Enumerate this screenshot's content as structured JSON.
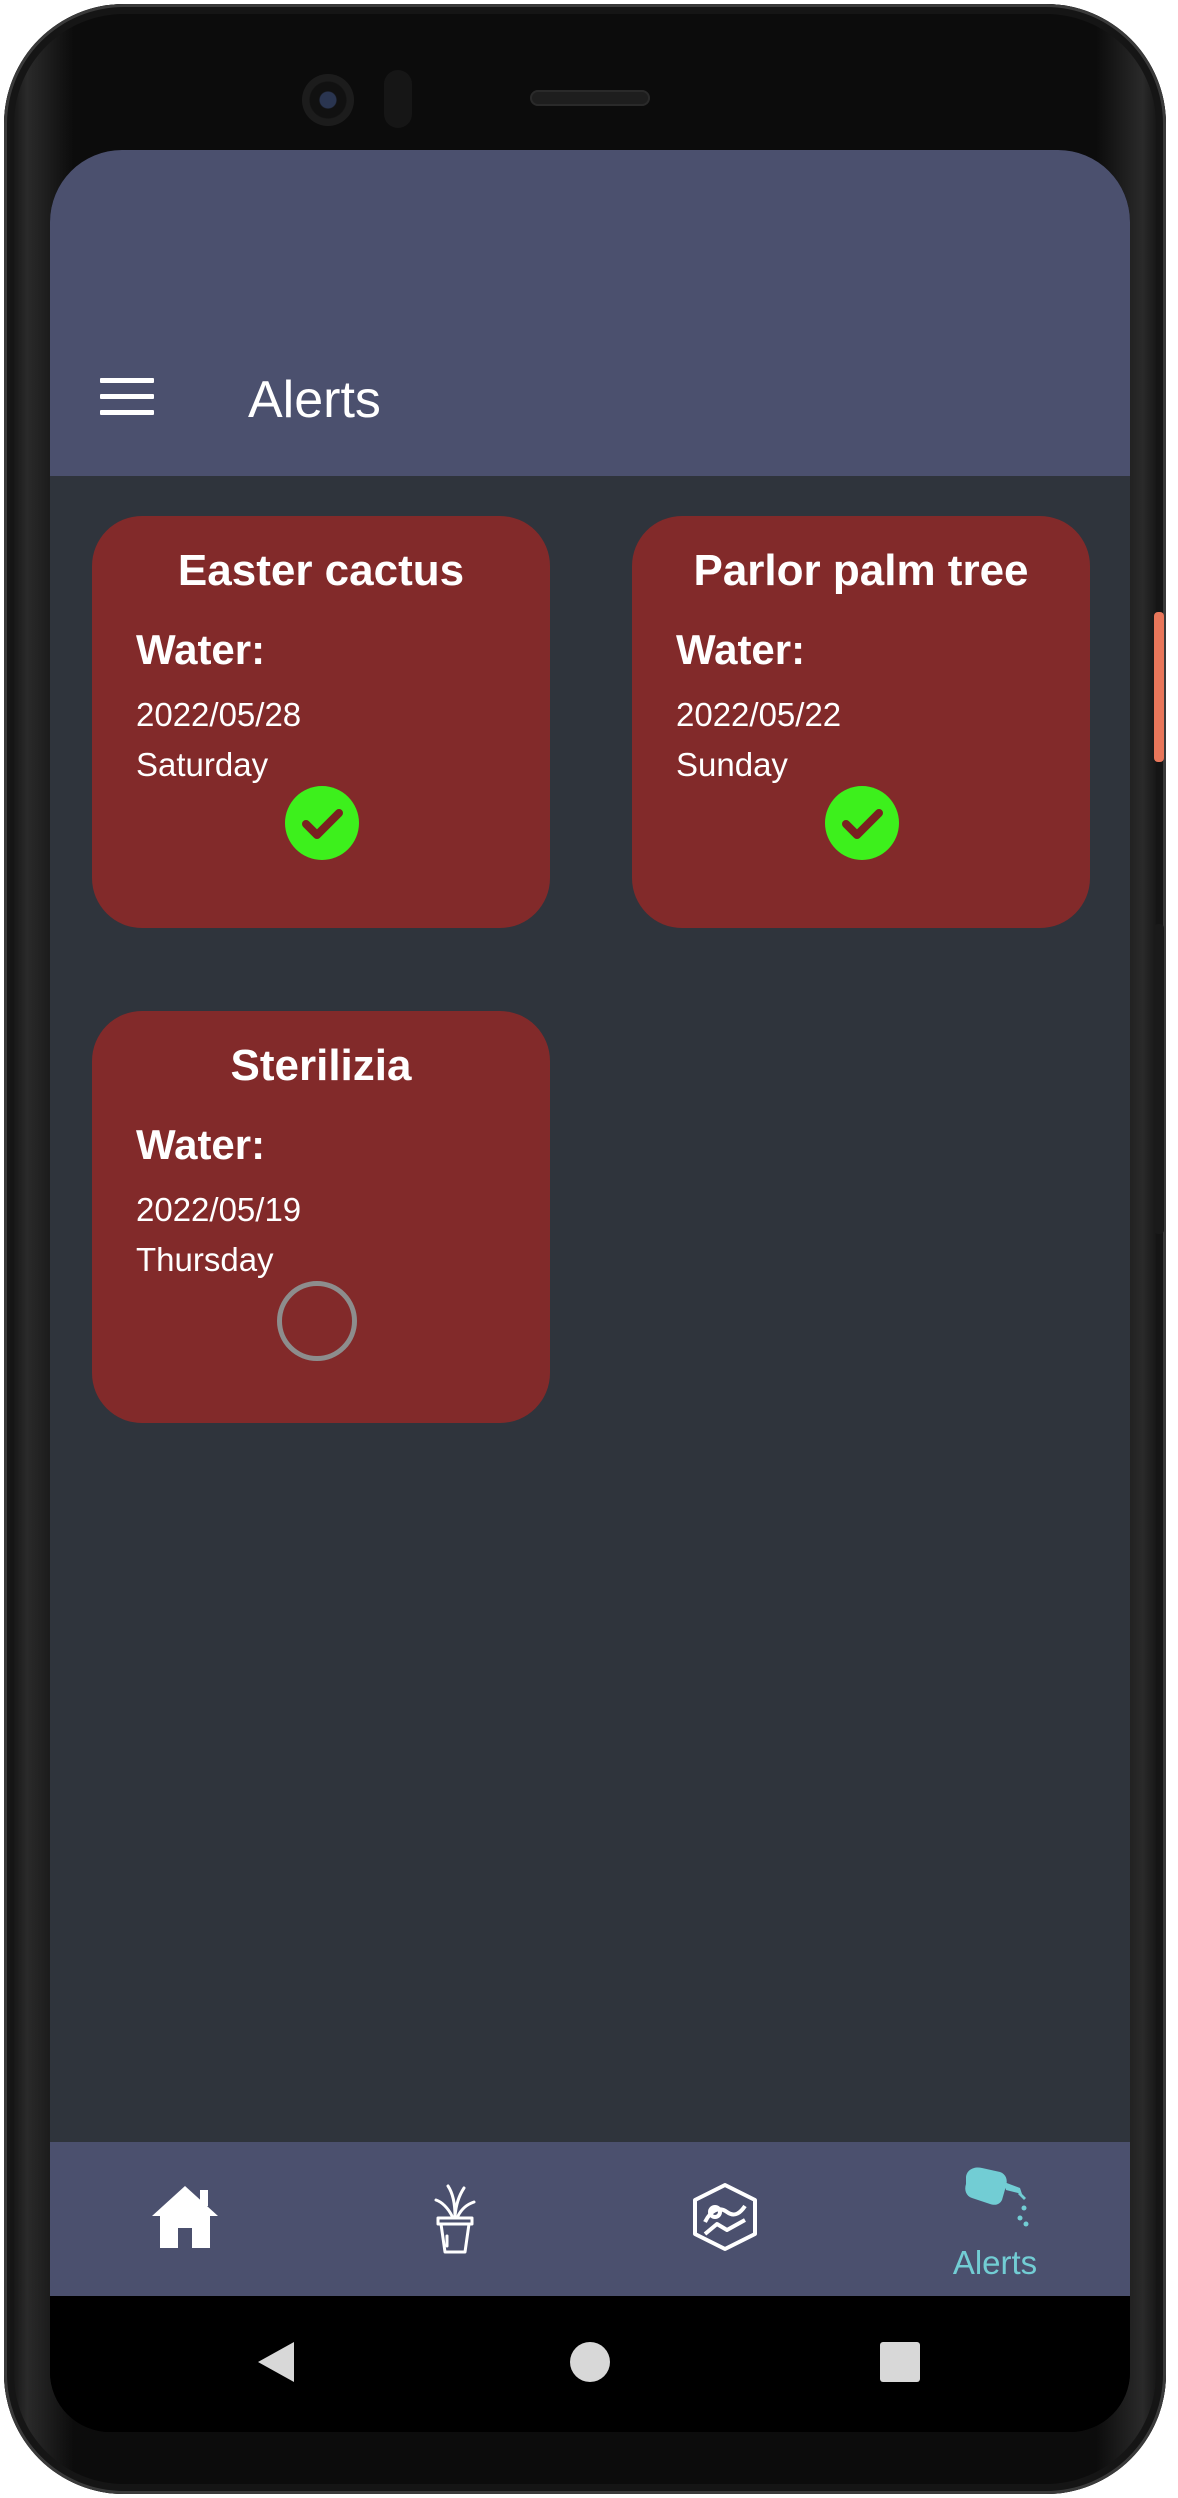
{
  "app_bar": {
    "title": "Alerts"
  },
  "alerts": [
    {
      "plant": "Easter cactus",
      "task": "Water:",
      "date": "2022/05/28",
      "weekday": "Saturday",
      "done": true
    },
    {
      "plant": "Parlor palm tree",
      "task": "Water:",
      "date": "2022/05/22",
      "weekday": "Sunday",
      "done": true
    },
    {
      "plant": "Sterilizia",
      "task": "Water:",
      "date": "2022/05/19",
      "weekday": "Thursday",
      "done": false
    }
  ],
  "bottom_nav": {
    "items": [
      {
        "icon": "home-icon",
        "label": ""
      },
      {
        "icon": "plant-pot-icon",
        "label": ""
      },
      {
        "icon": "plant-scan-icon",
        "label": ""
      },
      {
        "icon": "watering-can-icon",
        "label": "Alerts",
        "active": true
      }
    ]
  },
  "colors": {
    "app_bar": "#4b506e",
    "background": "#2f343c",
    "card": "#822a2a",
    "check": "#3df01c",
    "active_nav": "#72cdd4"
  }
}
